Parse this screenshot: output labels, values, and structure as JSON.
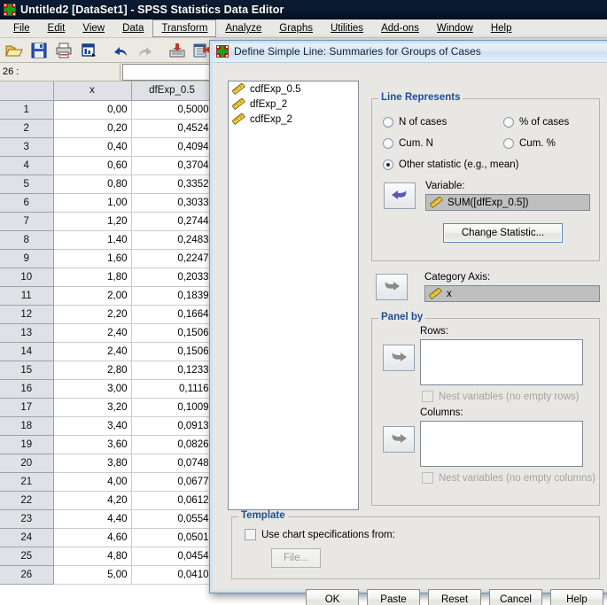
{
  "window": {
    "title": "Untitled2 [DataSet1] - SPSS Statistics Data Editor",
    "logo_icon": "spss-logo-icon"
  },
  "menubar": {
    "items": [
      {
        "label": "File",
        "active": false
      },
      {
        "label": "Edit",
        "active": false
      },
      {
        "label": "View",
        "active": false
      },
      {
        "label": "Data",
        "active": false
      },
      {
        "label": "Transform",
        "active": true
      },
      {
        "label": "Analyze",
        "active": false
      },
      {
        "label": "Graphs",
        "active": false
      },
      {
        "label": "Utilities",
        "active": false
      },
      {
        "label": "Add-ons",
        "active": false
      },
      {
        "label": "Window",
        "active": false
      },
      {
        "label": "Help",
        "active": false
      }
    ]
  },
  "toolbar": {
    "buttons": [
      {
        "icon": "open-file-icon",
        "title": "Open"
      },
      {
        "icon": "save-icon",
        "title": "Save"
      },
      {
        "icon": "print-icon",
        "title": "Print"
      },
      {
        "icon": "print-preview-icon",
        "title": "Print Preview"
      },
      {
        "icon": "undo-icon",
        "title": "Undo"
      },
      {
        "icon": "redo-icon",
        "title": "Redo"
      },
      {
        "icon": "goto-case-icon",
        "title": "Go to Case"
      },
      {
        "icon": "insert-variable-icon",
        "title": "Insert Variable"
      },
      {
        "icon": "find-icon",
        "title": "Find"
      }
    ]
  },
  "cellbar": {
    "cell_reference": "26 :",
    "cell_value": ""
  },
  "grid": {
    "columns": [
      "x",
      "dfExp_0.5"
    ],
    "rows": [
      {
        "n": "1",
        "x": "0,00",
        "d": "0,5000"
      },
      {
        "n": "2",
        "x": "0,20",
        "d": "0,4524"
      },
      {
        "n": "3",
        "x": "0,40",
        "d": "0,4094"
      },
      {
        "n": "4",
        "x": "0,60",
        "d": "0,3704"
      },
      {
        "n": "5",
        "x": "0,80",
        "d": "0,3352"
      },
      {
        "n": "6",
        "x": "1,00",
        "d": "0,3033"
      },
      {
        "n": "7",
        "x": "1,20",
        "d": "0,2744"
      },
      {
        "n": "8",
        "x": "1,40",
        "d": "0,2483"
      },
      {
        "n": "9",
        "x": "1,60",
        "d": "0,2247"
      },
      {
        "n": "10",
        "x": "1,80",
        "d": "0,2033"
      },
      {
        "n": "11",
        "x": "2,00",
        "d": "0,1839"
      },
      {
        "n": "12",
        "x": "2,20",
        "d": "0,1664"
      },
      {
        "n": "13",
        "x": "2,40",
        "d": "0,1506"
      },
      {
        "n": "14",
        "x": "2,40",
        "d": "0,1506"
      },
      {
        "n": "15",
        "x": "2,80",
        "d": "0,1233"
      },
      {
        "n": "16",
        "x": "3,00",
        "d": "0,1116"
      },
      {
        "n": "17",
        "x": "3,20",
        "d": "0,1009"
      },
      {
        "n": "18",
        "x": "3,40",
        "d": "0,0913"
      },
      {
        "n": "19",
        "x": "3,60",
        "d": "0,0826"
      },
      {
        "n": "20",
        "x": "3,80",
        "d": "0,0748"
      },
      {
        "n": "21",
        "x": "4,00",
        "d": "0,0677"
      },
      {
        "n": "22",
        "x": "4,20",
        "d": "0,0612"
      },
      {
        "n": "23",
        "x": "4,40",
        "d": "0,0554"
      },
      {
        "n": "24",
        "x": "4,60",
        "d": "0,0501"
      },
      {
        "n": "25",
        "x": "4,80",
        "d": "0,0454"
      },
      {
        "n": "26",
        "x": "5,00",
        "d": "0,0410"
      }
    ]
  },
  "dialog": {
    "title": "Define Simple Line: Summaries for Groups of Cases",
    "logo_icon": "spss-logo-icon",
    "variable_list": [
      {
        "label": "cdfExp_0.5",
        "icon": "scale-variable-icon"
      },
      {
        "label": "dfExp_2",
        "icon": "scale-variable-icon"
      },
      {
        "label": "cdfExp_2",
        "icon": "scale-variable-icon"
      }
    ],
    "line_represents": {
      "legend": "Line Represents",
      "options": [
        {
          "label": "N of cases",
          "checked": false
        },
        {
          "label": "% of cases",
          "checked": false
        },
        {
          "label": "Cum. N",
          "checked": false
        },
        {
          "label": "Cum. %",
          "checked": false
        },
        {
          "label": "Other statistic (e.g., mean)",
          "checked": true
        }
      ],
      "variable_label": "Variable:",
      "variable_value": "SUM([dfExp_0.5])",
      "change_statistic_label": "Change Statistic...",
      "move_arrow_icon": "arrow-left-icon"
    },
    "category_axis": {
      "label": "Category Axis:",
      "value": "x",
      "move_arrow_icon": "arrow-right-icon"
    },
    "panel_by": {
      "legend": "Panel by",
      "rows_label": "Rows:",
      "rows_value": "",
      "rows_nest_label": "Nest variables (no empty rows)",
      "rows_nest_checked": false,
      "columns_label": "Columns:",
      "columns_value": "",
      "columns_nest_label": "Nest variables (no empty columns)",
      "columns_nest_checked": false,
      "rows_arrow_icon": "arrow-right-icon",
      "columns_arrow_icon": "arrow-right-icon"
    },
    "template": {
      "legend": "Template",
      "use_chart_spec_label": "Use chart specifications from:",
      "use_chart_spec_checked": false,
      "file_button_label": "File..."
    },
    "buttons": [
      {
        "label": "OK"
      },
      {
        "label": "Paste"
      },
      {
        "label": "Reset"
      },
      {
        "label": "Cancel"
      },
      {
        "label": "Help"
      }
    ],
    "side_buttons": [
      {
        "name": "titles-button"
      },
      {
        "name": "options-button"
      }
    ]
  },
  "colors": {
    "accent_blue": "#1f4e9c",
    "title_bar": "#0a1a30",
    "dialog_bg": "#e8e7e4",
    "field_grey": "#bfbfbf",
    "grid_header": "#dfe1e6"
  }
}
